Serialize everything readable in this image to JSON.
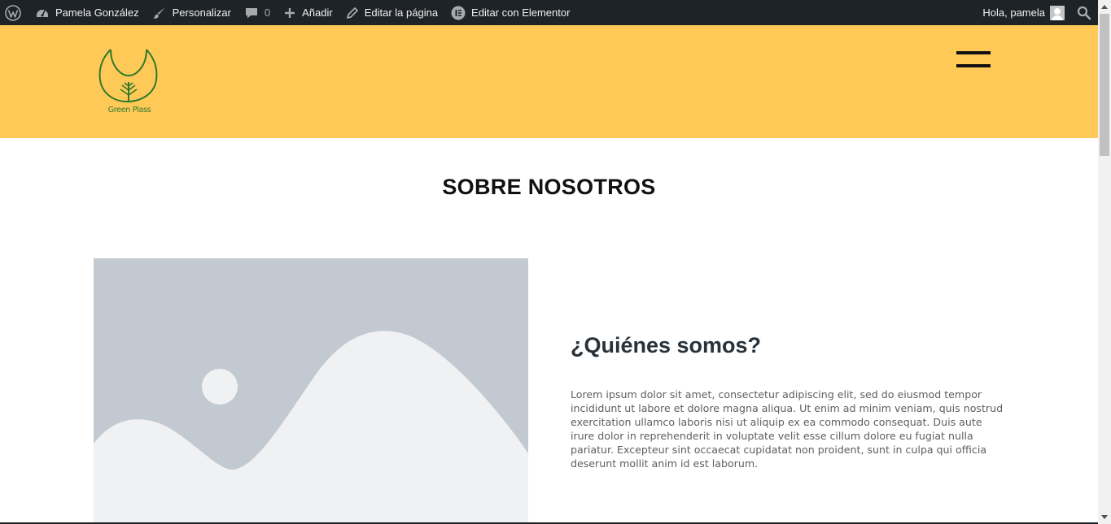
{
  "adminbar": {
    "site_name": "Pamela González",
    "customize": "Personalizar",
    "comments_count": "0",
    "add_new": "Añadir",
    "edit_page": "Editar la página",
    "edit_elementor": "Editar con Elementor",
    "greeting": "Hola, pamela",
    "icons": [
      "wordpress-icon",
      "dashboard-icon",
      "brush-icon",
      "comment-icon",
      "plus-icon",
      "pencil-icon",
      "elementor-icon",
      "avatar",
      "search-icon"
    ]
  },
  "header": {
    "logo_text": "Green Plass",
    "background": "#fec957",
    "menu_icon": "hamburger-icon"
  },
  "main": {
    "title": "SOBRE NOSOTROS",
    "about": {
      "heading": "¿Quiénes somos?",
      "body": "Lorem ipsum dolor sit amet, consectetur adipiscing elit, sed do eiusmod tempor incididunt ut labore et dolore magna aliqua. Ut enim ad minim veniam, quis nostrud exercitation ullamco laboris nisi ut aliquip ex ea commodo consequat. Duis aute irure dolor in reprehenderit in voluptate velit esse cillum dolore eu fugiat nulla pariatur. Excepteur sint occaecat cupidatat non proident, sunt in culpa qui officia deserunt mollit anim id est laborum."
    },
    "image": "placeholder-image"
  },
  "colors": {
    "adminbar_bg": "#1d2327",
    "header_bg": "#fec957",
    "logo_green": "#2e7a2b",
    "placeholder_bg": "#c2c9d0",
    "placeholder_fg": "#f0f1f2"
  }
}
